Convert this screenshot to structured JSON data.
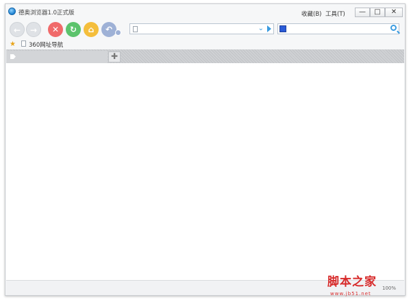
{
  "window": {
    "title": "德奥浏览器1.0正式版",
    "menu": [
      {
        "label": "收藏(B)"
      },
      {
        "label": "工具(T)"
      }
    ],
    "controls": {
      "minimize": "—",
      "maximize": "□",
      "close": "✕"
    }
  },
  "toolbar": {
    "back": "←",
    "forward": "→",
    "stop": "✕",
    "refresh": "↻",
    "home": "⌂",
    "undo": "↶",
    "address": {
      "value": "",
      "placeholder": ""
    },
    "search": {
      "value": "",
      "placeholder": ""
    }
  },
  "favorites": {
    "items": [
      {
        "label": "360网址导航"
      }
    ]
  },
  "tabs": {
    "new_tab": "✚"
  },
  "status": {
    "zoom": "100%"
  },
  "watermark": {
    "text": "脚本之家",
    "url": "www.jb51.net"
  },
  "colors": {
    "stop": "#f06a6a",
    "refresh": "#5cc36d",
    "home": "#f4be3c",
    "undo": "#9eb1d6",
    "accent": "#3a9be0"
  }
}
